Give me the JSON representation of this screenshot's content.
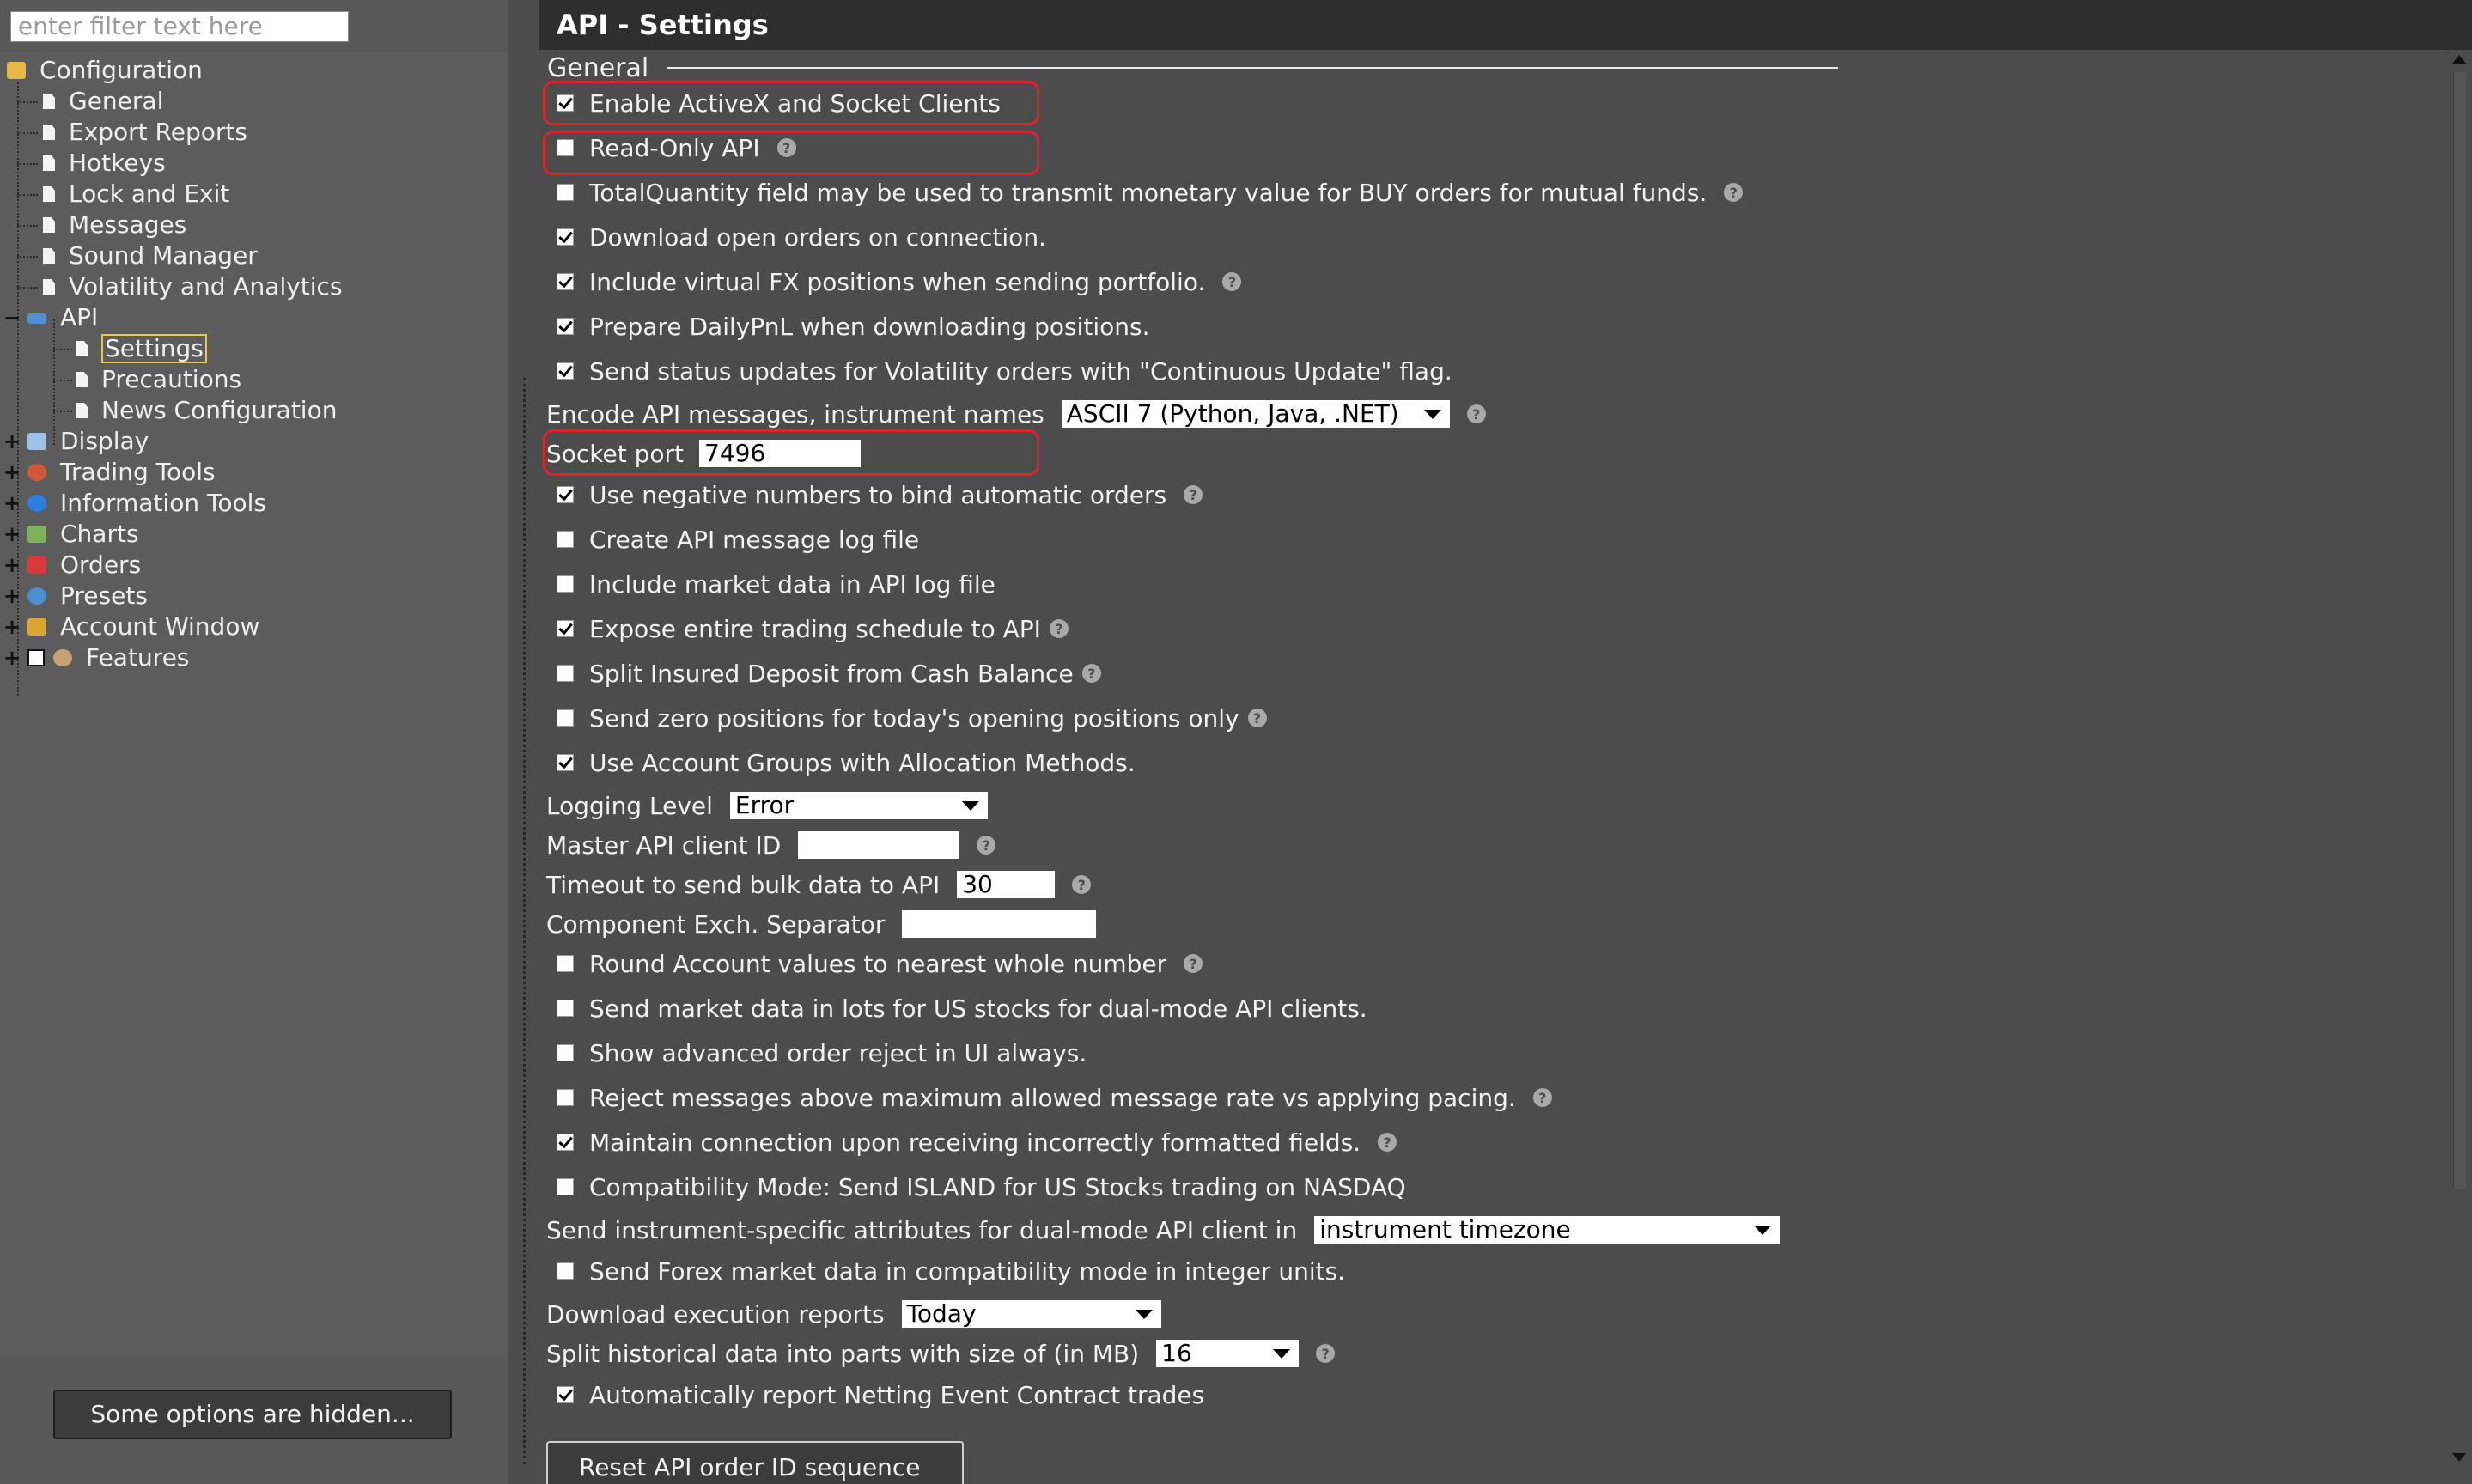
{
  "filter": {
    "placeholder": "enter filter text here"
  },
  "tree": {
    "root": "Configuration",
    "children": [
      "General",
      "Export Reports",
      "Hotkeys",
      "Lock and Exit",
      "Messages",
      "Sound Manager",
      "Volatility and Analytics"
    ],
    "api": {
      "label": "API",
      "children": [
        "Settings",
        "Precautions",
        "News Configuration"
      ],
      "selected": "Settings"
    },
    "groups": [
      "Display",
      "Trading Tools",
      "Information Tools",
      "Charts",
      "Orders",
      "Presets",
      "Account Window",
      "Features"
    ]
  },
  "hidden_button": "Some options are hidden...",
  "page": {
    "title": "API - Settings",
    "section": "General"
  },
  "settings": {
    "enable_activex": {
      "label": "Enable ActiveX and Socket Clients",
      "checked": true
    },
    "read_only": {
      "label": "Read-Only API",
      "checked": false
    },
    "total_quantity": {
      "label": "TotalQuantity field may be used to transmit monetary value for BUY orders for mutual funds.",
      "checked": false
    },
    "download_open_orders": {
      "label": "Download open orders on connection.",
      "checked": true
    },
    "include_virtual_fx": {
      "label": "Include virtual FX positions when sending portfolio.",
      "checked": true
    },
    "prepare_daily_pnl": {
      "label": "Prepare DailyPnL when downloading positions.",
      "checked": true
    },
    "send_status_updates": {
      "label": "Send status updates for Volatility orders with \"Continuous Update\" flag.",
      "checked": true
    },
    "encode": {
      "label": "Encode API messages, instrument names",
      "value": "ASCII 7 (Python, Java, .NET)"
    },
    "socket_port": {
      "label": "Socket port",
      "value": "7496"
    },
    "negative_numbers": {
      "label": "Use negative numbers to bind automatic orders",
      "checked": true
    },
    "create_log": {
      "label": "Create API message log file",
      "checked": false
    },
    "include_market_data": {
      "label": "Include market data in API log file",
      "checked": false
    },
    "expose_schedule": {
      "label": "Expose entire trading schedule to API",
      "checked": true
    },
    "split_insured": {
      "label": "Split Insured Deposit from Cash Balance",
      "checked": false
    },
    "send_zero_positions": {
      "label": "Send zero positions for today's opening positions only",
      "checked": false
    },
    "account_groups": {
      "label": "Use Account Groups with Allocation Methods.",
      "checked": true
    },
    "logging_level": {
      "label": "Logging Level",
      "value": "Error"
    },
    "master_client_id": {
      "label": "Master API client ID",
      "value": ""
    },
    "timeout_bulk": {
      "label": "Timeout to send bulk data to API",
      "value": "30"
    },
    "component_separator": {
      "label": "Component Exch. Separator",
      "value": ""
    },
    "round_account": {
      "label": "Round Account values to nearest whole number",
      "checked": false
    },
    "send_market_lots": {
      "label": "Send market data in lots for US stocks for dual-mode API clients.",
      "checked": false
    },
    "advanced_reject": {
      "label": "Show advanced order reject in UI always.",
      "checked": false
    },
    "reject_messages": {
      "label": "Reject messages above maximum allowed message rate vs applying pacing.",
      "checked": false
    },
    "maintain_connection": {
      "label": "Maintain connection upon receiving incorrectly formatted fields.",
      "checked": true
    },
    "compatibility_mode": {
      "label": "Compatibility Mode: Send ISLAND for US Stocks trading on NASDAQ",
      "checked": false
    },
    "instrument_attributes": {
      "label": "Send instrument-specific attributes for dual-mode API client in",
      "value": "instrument timezone"
    },
    "forex_integer": {
      "label": "Send Forex market data in compatibility mode in integer units.",
      "checked": false
    },
    "download_execution": {
      "label": "Download execution reports",
      "value": "Today"
    },
    "split_historical": {
      "label": "Split historical data into parts with size of (in MB)",
      "value": "16"
    },
    "netting_event": {
      "label": "Automatically report Netting Event Contract trades",
      "checked": true
    }
  },
  "reset_button": "Reset API order ID sequence",
  "colors": {
    "highlight_border": "#e0202a",
    "selected_outline": "#e2c85a",
    "panel_bg": "#4c4c4c",
    "title_bar": "#2e2e2e"
  },
  "icons": {
    "help": "?"
  }
}
